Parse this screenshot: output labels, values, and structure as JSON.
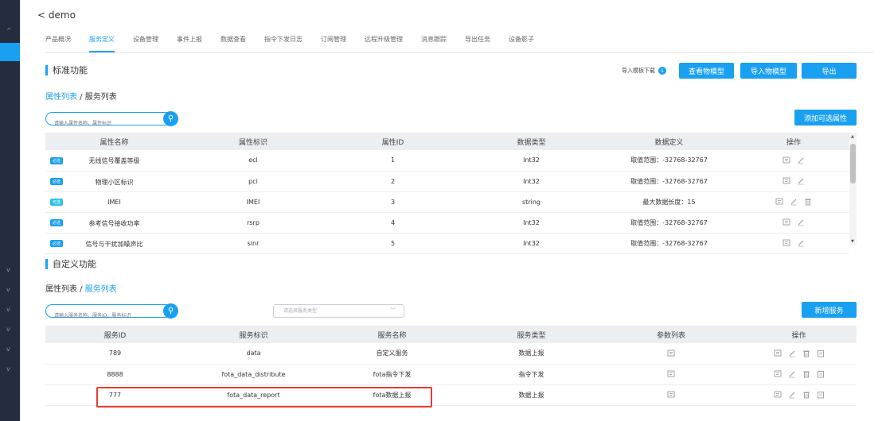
{
  "header": {
    "back_label": "demo"
  },
  "tabs": [
    {
      "label": "产品概况",
      "active": false
    },
    {
      "label": "服务定义",
      "active": true
    },
    {
      "label": "设备管理",
      "active": false
    },
    {
      "label": "事件上报",
      "active": false
    },
    {
      "label": "数据查看",
      "active": false
    },
    {
      "label": "指令下发日志",
      "active": false
    },
    {
      "label": "订阅管理",
      "active": false
    },
    {
      "label": "远程升级管理",
      "active": false
    },
    {
      "label": "消息跟踪",
      "active": false
    },
    {
      "label": "导出任务",
      "active": false
    },
    {
      "label": "设备影子",
      "active": false
    }
  ],
  "standard": {
    "title": "标准功能",
    "crumb_props": "属性列表",
    "crumb_sep": " / ",
    "crumb_services": "服务列表",
    "import_template": "导入模板下载",
    "btn_view_model": "查看物模型",
    "btn_import_model": "导入物模型",
    "btn_export": "导出",
    "search_placeholder": "请输入属性名称、属性标识",
    "btn_add_optional": "添加可选属性",
    "columns": [
      "属性名称",
      "属性标识",
      "属性ID",
      "数据类型",
      "数据定义",
      "操作"
    ],
    "rows": [
      {
        "badge": "必选",
        "name": "无线信号覆盖等级",
        "ident": "ecl",
        "id": "1",
        "type": "Int32",
        "def": "取值范围：-32768-32767",
        "deletable": false
      },
      {
        "badge": "必选",
        "name": "物理小区标识",
        "ident": "pci",
        "id": "2",
        "type": "Int32",
        "def": "取值范围：-32768-32767",
        "deletable": false
      },
      {
        "badge": "可选",
        "name": "IMEI",
        "ident": "IMEI",
        "id": "3",
        "type": "string",
        "def": "最大数据长度：15",
        "deletable": true
      },
      {
        "badge": "必选",
        "name": "参考信号接收功率",
        "ident": "rsrp",
        "id": "4",
        "type": "Int32",
        "def": "取值范围：-32768-32767",
        "deletable": false
      },
      {
        "badge": "必选",
        "name": "信号与干扰加噪声比",
        "ident": "sinr",
        "id": "5",
        "type": "Int32",
        "def": "取值范围：-32768-32767",
        "deletable": false
      }
    ]
  },
  "custom": {
    "title": "自定义功能",
    "crumb_props": "属性列表",
    "crumb_sep": " / ",
    "crumb_services": "服务列表",
    "search_placeholder": "请输入服务名称、服务ID、服务标识",
    "select_placeholder": "请选择服务类型",
    "btn_add_service": "新增服务",
    "columns": [
      "服务ID",
      "服务标识",
      "服务名称",
      "服务类型",
      "参数列表",
      "操作"
    ],
    "rows": [
      {
        "id": "789",
        "ident": "data",
        "name": "自定义服务",
        "type": "数据上报",
        "highlighted": false
      },
      {
        "id": "8888",
        "ident": "fota_data_distribute",
        "name": "fota指令下发",
        "type": "指令下发",
        "highlighted": false
      },
      {
        "id": "777",
        "ident": "fota_data_report",
        "name": "fota数据上报",
        "type": "数据上报",
        "highlighted": true
      }
    ]
  },
  "colors": {
    "accent": "#1aa0f0",
    "sidebar": "#242d3d",
    "highlight": "#e83a32"
  }
}
